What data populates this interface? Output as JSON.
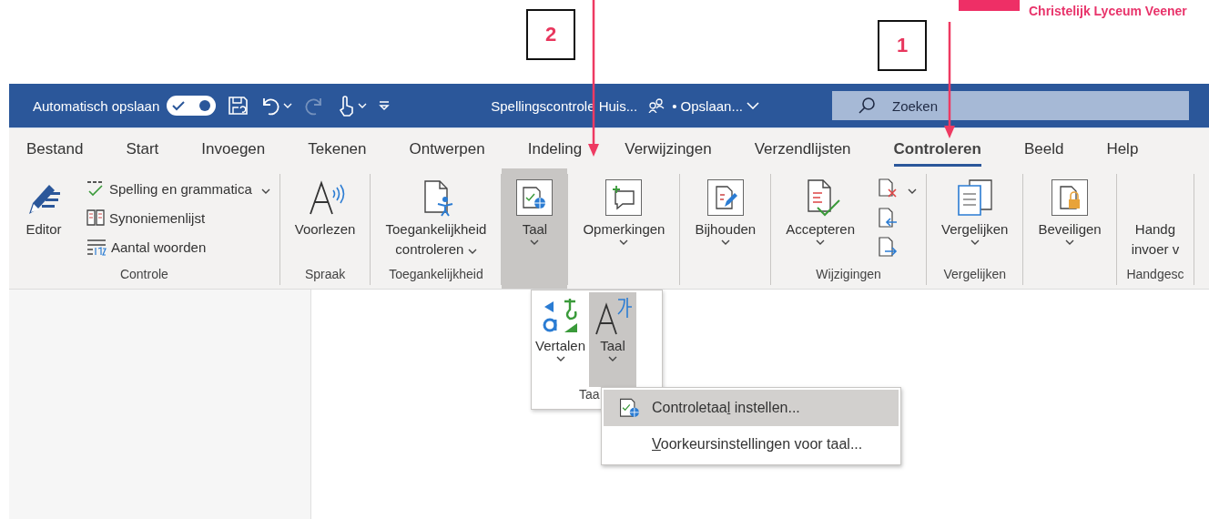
{
  "annotations": [
    {
      "kind": "callout",
      "number": "2"
    },
    {
      "kind": "callout",
      "number": "1"
    }
  ],
  "brand_label": "Christelijk Lyceum Veener",
  "title_bar": {
    "autosave": {
      "label": "Automatisch opslaan",
      "on": true
    },
    "quick_access": [
      {
        "kind": "save"
      },
      {
        "kind": "undo",
        "dropdown": true
      },
      {
        "kind": "redo",
        "disabled": true
      },
      {
        "kind": "touch",
        "dropdown": true
      },
      {
        "kind": "customize"
      }
    ],
    "document_title": "Spellingscontrole Huis...",
    "save_status": "• Opslaan...",
    "search": {
      "placeholder": "Zoeken"
    }
  },
  "tabs": [
    {
      "label": "Bestand",
      "selected": false
    },
    {
      "label": "Start",
      "selected": false
    },
    {
      "label": "Invoegen",
      "selected": false
    },
    {
      "label": "Tekenen",
      "selected": false
    },
    {
      "label": "Ontwerpen",
      "selected": false
    },
    {
      "label": "Indeling",
      "selected": false
    },
    {
      "label": "Verwijzingen",
      "selected": false
    },
    {
      "label": "Verzendlijsten",
      "selected": false
    },
    {
      "label": "Controleren",
      "selected": true
    },
    {
      "label": "Beeld",
      "selected": false
    },
    {
      "label": "Help",
      "selected": false
    }
  ],
  "ribbon": {
    "groups": [
      {
        "label": "Controle",
        "items": [
          {
            "kind": "large",
            "label": "Editor"
          },
          {
            "kind": "small",
            "label": "Spelling en grammatica",
            "dropdown": true
          },
          {
            "kind": "small",
            "label": "Synoniemenlijst"
          },
          {
            "kind": "small",
            "label": "Aantal woorden"
          }
        ]
      },
      {
        "label": "Spraak",
        "items": [
          {
            "kind": "large",
            "label": "Voorlezen"
          }
        ]
      },
      {
        "label": "Toegankelijkheid",
        "items": [
          {
            "kind": "large",
            "label": [
              "Toegankelijkheid",
              "controleren"
            ],
            "dropdown": true
          }
        ]
      },
      {
        "items": [
          {
            "kind": "framed",
            "label": "Taal",
            "dropdown": true,
            "pressed": true
          }
        ]
      },
      {
        "items": [
          {
            "kind": "framed",
            "label": "Opmerkingen",
            "dropdown": true,
            "pressed": false
          }
        ]
      },
      {
        "items": [
          {
            "kind": "framed",
            "label": "Bijhouden",
            "dropdown": true,
            "pressed": false
          }
        ]
      },
      {
        "label": "Wijzigingen",
        "items": [
          {
            "kind": "large",
            "label": "Accepteren",
            "dropdown": true
          },
          {
            "kind": "icon",
            "dropdown": true
          },
          {
            "kind": "icon"
          },
          {
            "kind": "icon"
          }
        ]
      },
      {
        "label": "Vergelijken",
        "items": [
          {
            "kind": "large",
            "label": "Vergelijken",
            "dropdown": true
          }
        ]
      },
      {
        "items": [
          {
            "kind": "framed",
            "label": "Beveiligen",
            "dropdown": true,
            "pressed": false
          }
        ]
      },
      {
        "label": "Handgesc",
        "items": [
          {
            "kind": "large",
            "label": [
              "Handg",
              "invoer v"
            ]
          }
        ]
      }
    ]
  },
  "language_dropdown": {
    "buttons": [
      {
        "label": "Vertalen",
        "pressed": false
      },
      {
        "label": "Taal",
        "pressed": true
      }
    ],
    "group_label": "Taa",
    "menu": [
      {
        "label_start": "Controletaa",
        "access_key": "l",
        "label_end": " instellen...",
        "selected": true,
        "icon": true
      },
      {
        "access_key": "V",
        "label_end": "oorkeursinstellingen voor taal...",
        "selected": false,
        "icon": false
      }
    ]
  }
}
